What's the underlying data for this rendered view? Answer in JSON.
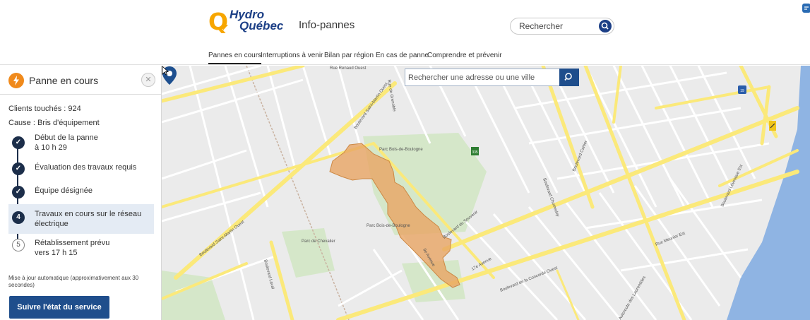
{
  "brand": {
    "logo_line1": "Hydro",
    "logo_line2": "Québec",
    "app_name": "Info-pannes",
    "accent_color": "#1c3f86",
    "logo_color": "#f7a600"
  },
  "search": {
    "placeholder": "Rechercher",
    "icon": "search-icon"
  },
  "nav": {
    "items": [
      {
        "label": "Pannes en cours",
        "active": true
      },
      {
        "label": "Interruptions à venir",
        "active": false
      },
      {
        "label": "Bilan par région",
        "active": false
      },
      {
        "label": "En cas de panne",
        "active": false
      },
      {
        "label": "Comprendre et prévenir",
        "active": false
      }
    ]
  },
  "panel": {
    "title": "Panne en cours",
    "close_icon": "close-icon",
    "clients_label": "Clients touchés :",
    "clients_value": "924",
    "cause_label": "Cause :",
    "cause_value": "Bris d'équipement",
    "steps": [
      {
        "label": "Début de la panne",
        "sub": "à 10 h 29",
        "status": "done",
        "marker": "✓"
      },
      {
        "label": "Évaluation des travaux requis",
        "sub": "",
        "status": "done",
        "marker": "✓"
      },
      {
        "label": "Équipe désignée",
        "sub": "",
        "status": "done",
        "marker": "✓"
      },
      {
        "label": "Travaux en cours sur le réseau",
        "sub": "électrique",
        "status": "current",
        "marker": "4"
      },
      {
        "label": "Rétablissement prévu",
        "sub": "vers 17 h 15",
        "status": "pending",
        "marker": "5"
      }
    ],
    "auto_update": "Mise à jour automatique (approximativement aux 30 secondes)",
    "follow_button": "Suivre l'état du service",
    "outage_color": "#e8a564"
  },
  "map": {
    "search_placeholder": "Rechercher une adresse ou une ville",
    "water_color": "#8fb4e3",
    "road_color": "#fbe97a",
    "labels": {
      "boul_saint_martin": "Boulevard Saint-Martin Ouest",
      "parc_bois": "Parc Bois-de-Boulogne",
      "boul_souvenir": "Boulevard du Souvenir",
      "boul_concorde": "Boulevard de la Concorde Ouest",
      "boul_laval": "Boulevard Laval",
      "rue_grenoble": "Rue de Grenoble",
      "boul_cartier": "Boulevard Cartier",
      "autoroute": "Autoroute des Laurentides",
      "rue_meunier": "Rue Meunier Est",
      "boul_levesque": "Boulevard Lévesque Est",
      "boul_chomedey": "Boulevard Chomedey",
      "parc_chevalier": "Parc de Chevalier",
      "rue_renaud": "Rue Renaud Ouest",
      "ave_9": "9e Avenue",
      "ave_17": "17e Avenue",
      "route_shield": "335",
      "highway_shield": "19"
    }
  }
}
